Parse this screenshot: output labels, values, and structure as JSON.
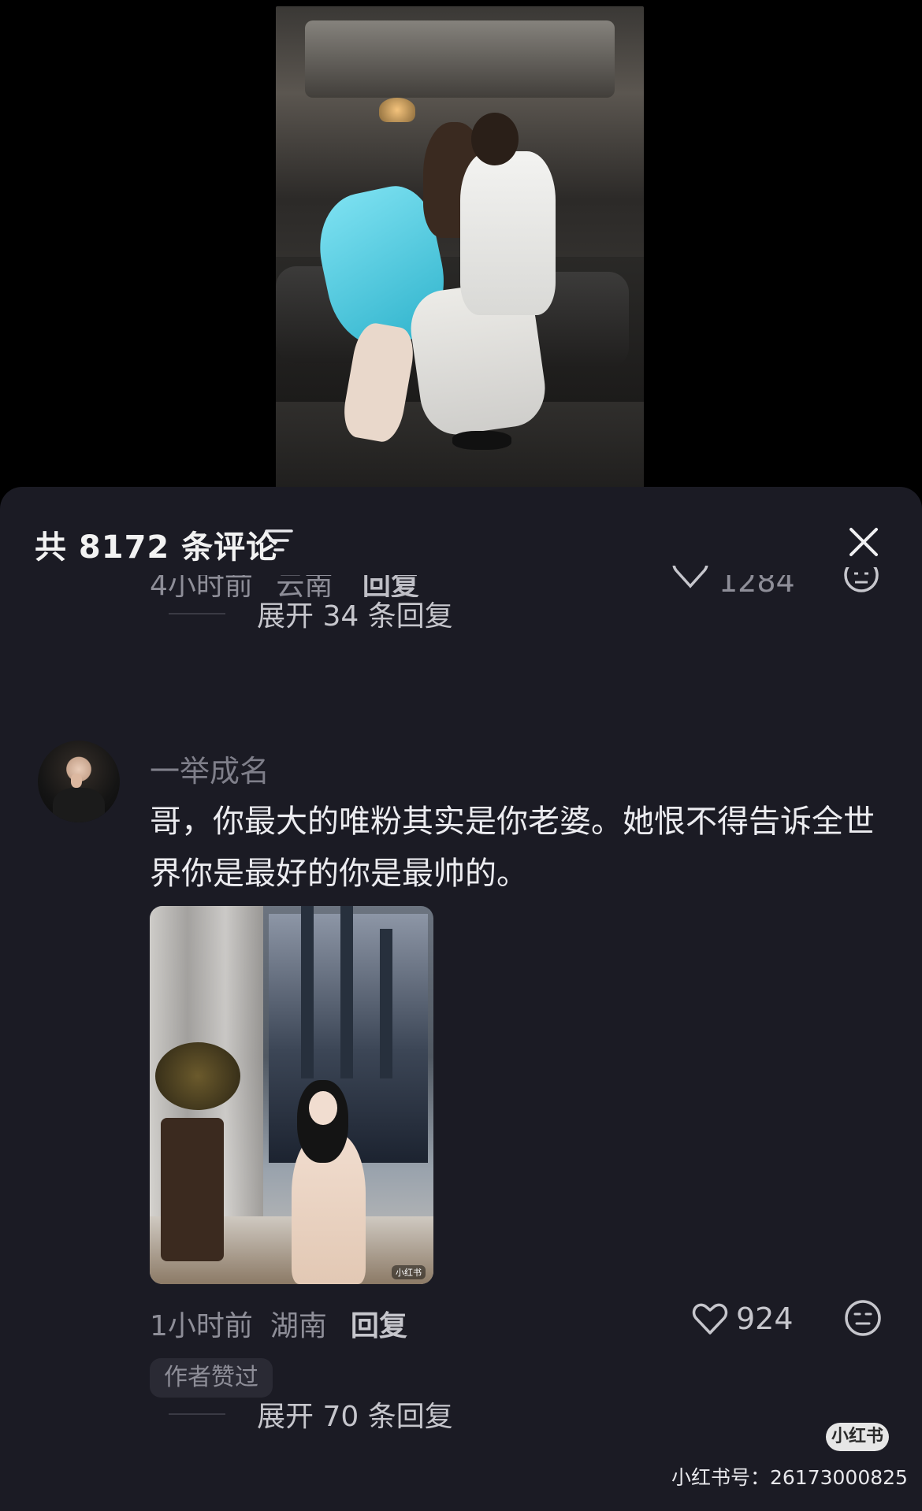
{
  "sheet": {
    "title": "共 8172 条评论",
    "sort_icon": "filter-lines-icon",
    "close_icon": "close-x-icon"
  },
  "previous_comment": {
    "time": "4小时前",
    "location": "云南",
    "reply_label": "回复",
    "likes": "1284",
    "expand_label": "展开 34 条回复"
  },
  "comment": {
    "username": "一举成名",
    "text": "哥，你最大的唯粉其实是你老婆。她恨不得告诉全世界你是最好的你是最帅的。",
    "image_watermark": "小红书",
    "time": "1小时前",
    "location": "湖南",
    "reply_label": "回复",
    "likes": "924",
    "badge": "作者赞过",
    "expand_label": "展开 70 条回复"
  },
  "watermark": {
    "logo_text": "小红书",
    "id_text": "小红书号：26173000825"
  },
  "colors": {
    "sheet_bg": "#1b1b24",
    "text_primary": "#ececf0",
    "text_secondary": "#8e8e98"
  }
}
